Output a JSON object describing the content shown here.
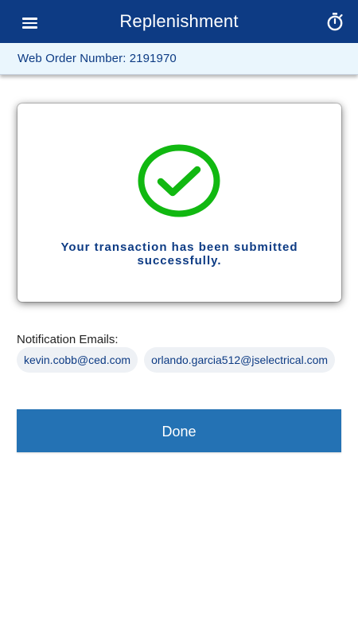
{
  "header": {
    "title": "Replenishment",
    "menu_icon": "hamburger-menu-icon",
    "timer_icon": "stopwatch-icon"
  },
  "order": {
    "label": "Web Order Number: 2191970"
  },
  "confirmation": {
    "icon": "check-circle-icon",
    "message": "Your transaction has been submitted successfully."
  },
  "notifications": {
    "label": "Notification Emails:",
    "emails": [
      "kevin.cobb@ced.com",
      "orlando.garcia512@jselectrical.com"
    ]
  },
  "actions": {
    "done_label": "Done"
  },
  "colors": {
    "header_bg": "#0d3b84",
    "order_strip_bg": "#eaf6fd",
    "primary_text": "#0d3b84",
    "success_green": "#11b811",
    "done_button_bg": "#2472b4",
    "chip_bg": "#eef1f5"
  }
}
